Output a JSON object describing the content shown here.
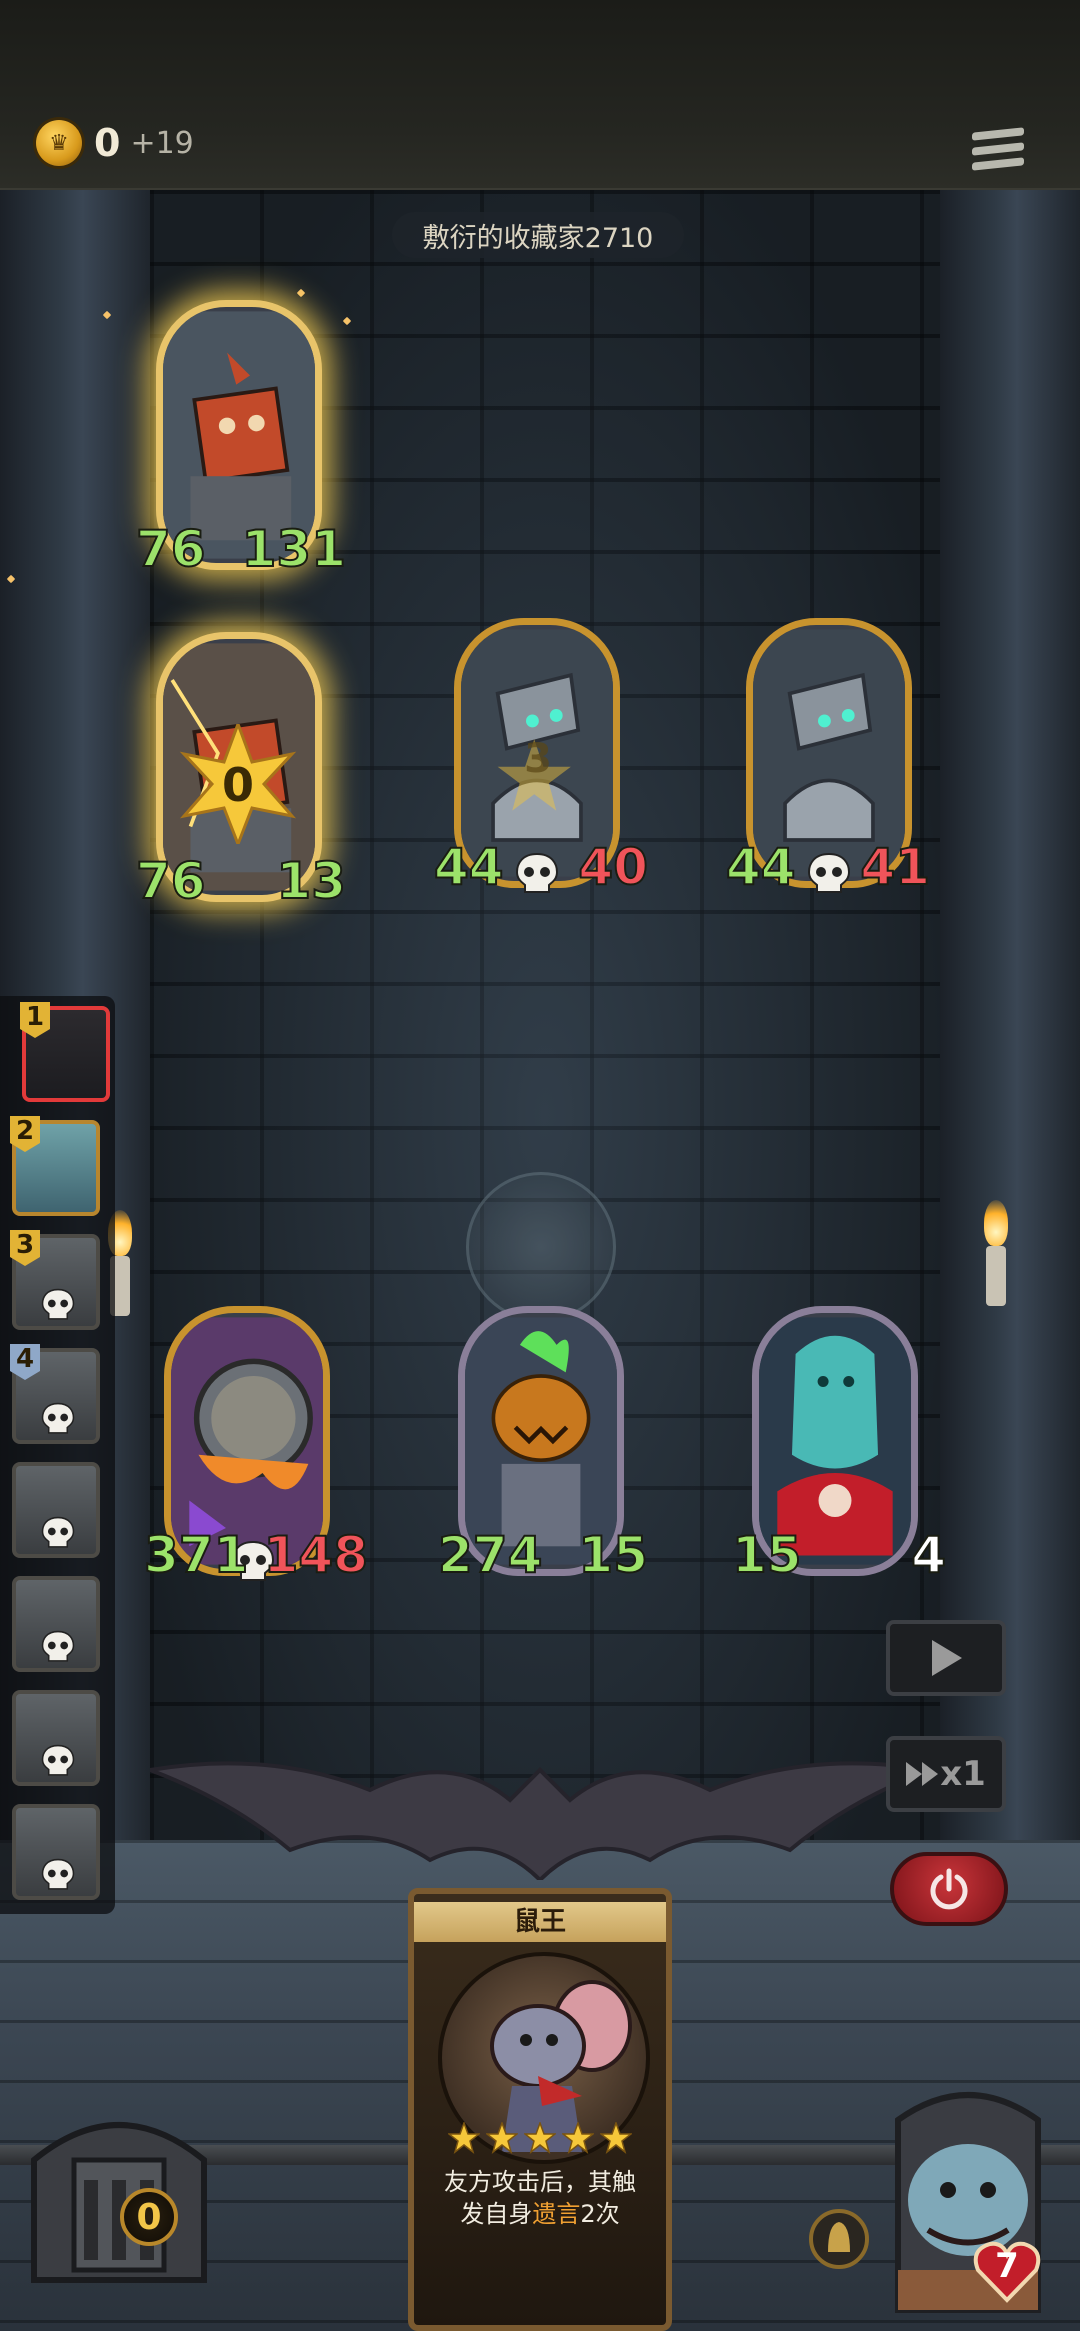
{
  "header": {
    "coins": "0",
    "coin_delta": "+19"
  },
  "opponent": {
    "name": "敷衍的收藏家2710"
  },
  "enemy_board": [
    {
      "id": "construct-a",
      "attack": "76",
      "health": "131",
      "health_color": "#9ce26a",
      "frame": "silver",
      "glow": true
    },
    {
      "id": "construct-b",
      "attack": "76",
      "health": "13",
      "health_color": "#9ce26a",
      "frame": "glow",
      "badge_value": "0"
    },
    {
      "id": "bell-golem-a",
      "attack": "44",
      "health": "40",
      "health_color": "#f0545a",
      "frame": "gold",
      "badge_value": "3",
      "skull": true
    },
    {
      "id": "bell-golem-b",
      "attack": "44",
      "health": "41",
      "health_color": "#f0545a",
      "frame": "gold",
      "skull": true
    }
  ],
  "player_board": [
    {
      "id": "cauldron-beast",
      "attack": "371",
      "health": "148",
      "health_color": "#f0545a",
      "frame": "gold",
      "skull": true
    },
    {
      "id": "pumpkin-knight",
      "attack": "274",
      "health": "15",
      "health_color": "#9ce26a",
      "frame": "silver"
    },
    {
      "id": "ghost-summoner",
      "attack": "15",
      "health": "4",
      "health_color": "#ffffff",
      "frame": "silver"
    }
  ],
  "turn_order": [
    {
      "num": "1",
      "state": "active"
    },
    {
      "num": "2",
      "state": "normal"
    },
    {
      "num": "3",
      "state": "dead"
    },
    {
      "num": "4",
      "state": "dead"
    },
    {
      "num": "",
      "state": "dead"
    },
    {
      "num": "",
      "state": "dead"
    },
    {
      "num": "",
      "state": "dead"
    },
    {
      "num": "",
      "state": "dead"
    }
  ],
  "controls": {
    "speed_label": "x1"
  },
  "chest": {
    "count": "0"
  },
  "hero_card": {
    "title": "鼠王",
    "stars": 5,
    "desc_part1": "友方攻击后，其触",
    "desc_part2": "发自身",
    "desc_highlight": "遗言",
    "desc_part3": "2次"
  },
  "boss": {
    "health": "7"
  },
  "colors": {
    "accent_gold": "#e2b335",
    "danger_red": "#e23a3a",
    "atk_green": "#9ce26a",
    "hp_red": "#f0545a"
  }
}
